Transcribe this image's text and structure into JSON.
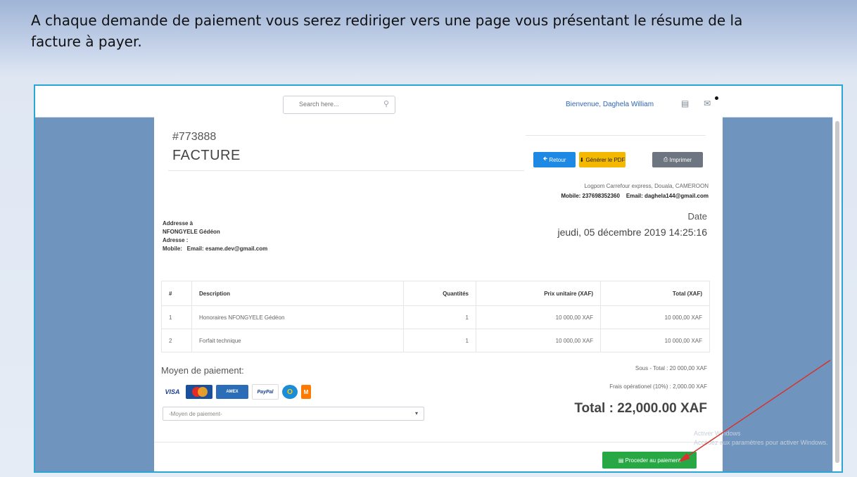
{
  "caption": "A chaque demande de paiement vous serez rediriger vers une page vous présentant le résume de la facture à payer.",
  "topbar": {
    "search_placeholder": "Search here...",
    "welcome": "Bienvenue, Daghela William"
  },
  "invoice": {
    "number": "#773888",
    "title": "FACTURE",
    "buttons": {
      "back": "Retour",
      "pdf": "Générer le PDF",
      "print": "Imprimer"
    },
    "company_address": "Logpom Carrefour express, Douala, CAMEROON",
    "company_mobile": "Mobile: 237698352360",
    "company_email": "Email: daghela144@gmail.com",
    "date_label": "Date",
    "date_value": "jeudi, 05 décembre 2019 14:25:16",
    "bill_to": {
      "label": "Addresse à",
      "name": "NFONGYELE Gédéon",
      "address": "Adresse :",
      "mobile": "Mobile:",
      "email": "Email: esame.dev@gmail.com"
    },
    "table": {
      "headers": [
        "#",
        "Description",
        "Quantités",
        "Prix unitaire (XAF)",
        "Total (XAF)"
      ],
      "rows": [
        [
          "1",
          "Honoraires NFONGYELE Gédéon",
          "1",
          "10 000,00 XAF",
          "10 000,00 XAF"
        ],
        [
          "2",
          "Forfait technique",
          "1",
          "10 000,00 XAF",
          "10 000,00 XAF"
        ]
      ]
    },
    "payment": {
      "title": "Moyen de paiement:",
      "select_placeholder": "-Moyen de paiement-",
      "cards": [
        "VISA",
        "MasterCard",
        "American Express",
        "PayPal",
        "Orange Money",
        "MTN"
      ]
    },
    "subtotal": "Sous - Total : 20 000,00 XAF",
    "fees": "Frais opérationel (10%) : 2,000.00 XAF",
    "total": "Total : 22,000.00 XAF",
    "proceed_button": "Proceder au paiement"
  },
  "watermark": {
    "line1": "Activer Windows",
    "line2": "Accédez aux paramètres pour activer Windows."
  },
  "colors": {
    "frame_border": "#2aa6d4",
    "back_button": "#1e88e5",
    "pdf_button": "#f5b800",
    "print_button": "#6d7680",
    "proceed_button": "#28a745",
    "arrow": "#d9312b"
  }
}
